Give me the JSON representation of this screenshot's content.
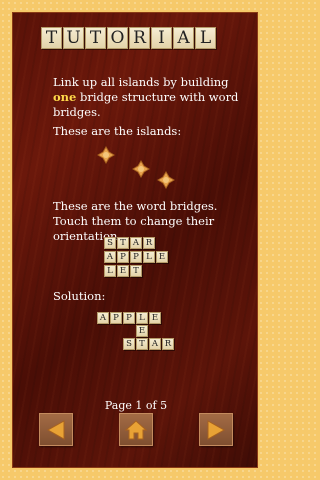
{
  "title_letters": [
    "T",
    "U",
    "T",
    "O",
    "R",
    "I",
    "A",
    "L"
  ],
  "intro": {
    "before": "Link up all islands by building",
    "highlight": "one",
    "after": "bridge structure with word bridges."
  },
  "islands_label": "These are the islands:",
  "bridges_text": "These are the word bridges. Touch them to change their orientation.",
  "words": [
    [
      "S",
      "T",
      "A",
      "R"
    ],
    [
      "A",
      "P",
      "P",
      "L",
      "E"
    ],
    [
      "L",
      "E",
      "T"
    ]
  ],
  "solution_label": "Solution:",
  "solution": {
    "row1": [
      "A",
      "P",
      "P",
      "L",
      "E"
    ],
    "middle": "E",
    "row3": [
      "S",
      "T",
      "A",
      "R"
    ]
  },
  "page_indicator": "Page 1 of 5",
  "nav": {
    "prev": "left-arrow-icon",
    "home": "home-icon",
    "next": "right-arrow-icon"
  },
  "colors": {
    "arrow": "#e8a235",
    "highlight": "#ffd84a",
    "tile": "#efe3c2"
  }
}
